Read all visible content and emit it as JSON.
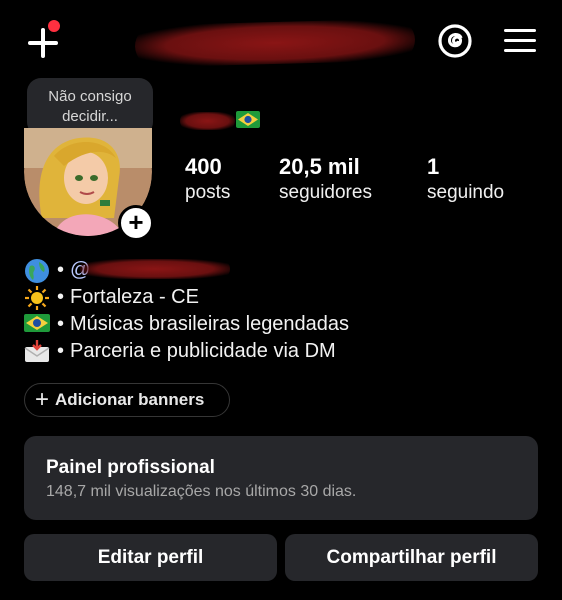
{
  "header": {
    "create_icon": "plus-icon",
    "threads_icon": "threads-icon",
    "menu_icon": "hamburger-menu-icon"
  },
  "note": {
    "line1": "Não consigo",
    "line2": "decidir..."
  },
  "stats": [
    {
      "value": "400",
      "label": "posts"
    },
    {
      "value": "20,5 mil",
      "label": "seguidores"
    },
    {
      "value": "1",
      "label": "seguindo"
    }
  ],
  "bio": {
    "handle_prefix": "@",
    "location": "Fortaleza - CE",
    "description": "Músicas brasileiras legendadas",
    "contact": "Parceria e publicidade via DM",
    "separator": "•"
  },
  "banners": {
    "label": "Adicionar banners"
  },
  "professional_panel": {
    "title": "Painel profissional",
    "subtitle": "148,7 mil visualizações nos últimos 30 dias."
  },
  "actions": {
    "edit_label": "Editar perfil",
    "share_label": "Compartilhar perfil"
  },
  "colors": {
    "background": "#000000",
    "card": "#26272b",
    "notification": "#ff3040",
    "muted_text": "#a8a8a8"
  }
}
